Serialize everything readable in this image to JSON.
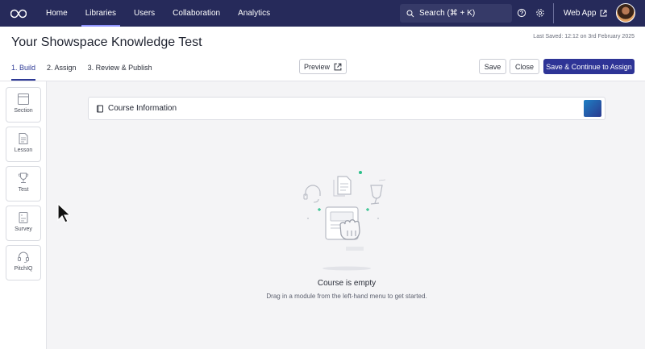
{
  "nav": {
    "items": [
      {
        "label": "Home"
      },
      {
        "label": "Libraries"
      },
      {
        "label": "Users"
      },
      {
        "label": "Collaboration"
      },
      {
        "label": "Analytics"
      }
    ],
    "active": "Libraries",
    "search_label": "Search (⌘ + K)",
    "web_app_label": "Web App",
    "icons": [
      "logo-icon",
      "search-icon",
      "help-icon",
      "gear-icon",
      "external-link-icon"
    ]
  },
  "header": {
    "title": "Your Showspace Knowledge Test",
    "last_saved": "Last Saved: 12:12 on 3rd February 2025",
    "steps": [
      {
        "label": "1. Build"
      },
      {
        "label": "2. Assign"
      },
      {
        "label": "3. Review & Publish"
      }
    ],
    "active_step": "1. Build",
    "preview_label": "Preview",
    "save_label": "Save",
    "close_label": "Close",
    "continue_label": "Save & Continue to Assign"
  },
  "sidebar": {
    "modules": [
      {
        "label": "Section",
        "icon": "section-icon"
      },
      {
        "label": "Lesson",
        "icon": "lesson-icon"
      },
      {
        "label": "Test",
        "icon": "trophy-icon"
      },
      {
        "label": "Survey",
        "icon": "survey-icon"
      },
      {
        "label": "PitchIQ",
        "icon": "headset-icon"
      }
    ]
  },
  "main": {
    "course_info_label": "Course Information",
    "empty_title": "Course is empty",
    "empty_subtitle": "Drag in a module from the left-hand menu to get started."
  },
  "colors": {
    "nav_bg": "#262a5a",
    "primary": "#2e3496",
    "accent_green": "#2bbf8a",
    "swatch": "#1e7fc4"
  }
}
